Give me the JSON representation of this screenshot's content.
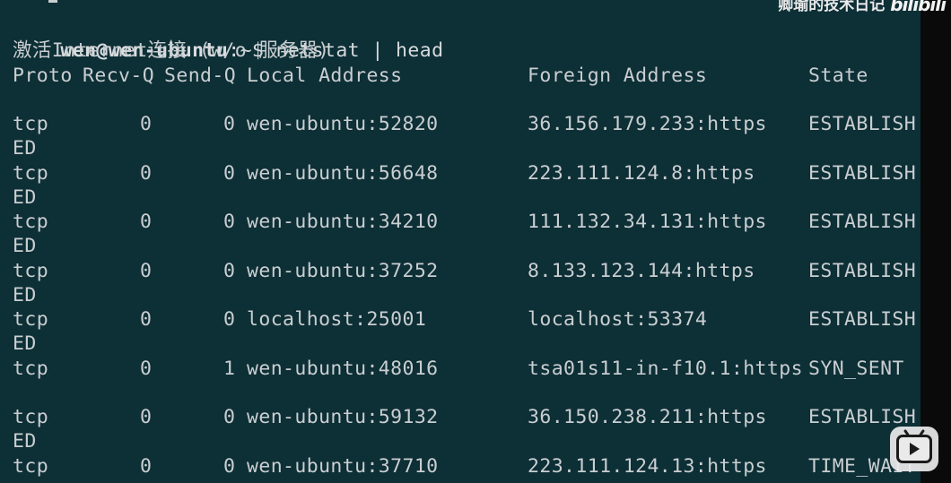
{
  "prompt": {
    "user_host": "wen@wen-ubuntu",
    "path": ":~$",
    "command": " netstat | head"
  },
  "heading": "激活Internet连接 (w/o 服务器)",
  "headers": {
    "proto": "Proto",
    "recvq": "Recv-Q",
    "sendq": "Send-Q",
    "local": "Local Address",
    "foreign": "Foreign Address",
    "state": "State"
  },
  "rows": [
    {
      "proto": "tcp",
      "recvq": "0",
      "sendq": "0",
      "local": "wen-ubuntu:52820",
      "foreign": "36.156.179.233:https",
      "state": "ESTABLISH",
      "wrap": "ED"
    },
    {
      "proto": "tcp",
      "recvq": "0",
      "sendq": "0",
      "local": "wen-ubuntu:56648",
      "foreign": "223.111.124.8:https",
      "state": "ESTABLISH",
      "wrap": "ED"
    },
    {
      "proto": "tcp",
      "recvq": "0",
      "sendq": "0",
      "local": "wen-ubuntu:34210",
      "foreign": "111.132.34.131:https",
      "state": "ESTABLISH",
      "wrap": "ED"
    },
    {
      "proto": "tcp",
      "recvq": "0",
      "sendq": "0",
      "local": "wen-ubuntu:37252",
      "foreign": "8.133.123.144:https",
      "state": "ESTABLISH",
      "wrap": "ED"
    },
    {
      "proto": "tcp",
      "recvq": "0",
      "sendq": "0",
      "local": "localhost:25001",
      "foreign": "localhost:53374",
      "state": "ESTABLISH",
      "wrap": "ED"
    },
    {
      "proto": "tcp",
      "recvq": "0",
      "sendq": "1",
      "local": "wen-ubuntu:48016",
      "foreign": "tsa01s11-in-f10.1:https",
      "state": "SYN_SENT",
      "wrap": ""
    },
    {
      "proto": "tcp",
      "recvq": "0",
      "sendq": "0",
      "local": "wen-ubuntu:59132",
      "foreign": "36.150.238.211:https",
      "state": "ESTABLISH",
      "wrap": "ED"
    },
    {
      "proto": "tcp",
      "recvq": "0",
      "sendq": "0",
      "local": "wen-ubuntu:37710",
      "foreign": "223.111.124.13:https",
      "state": "TIME_WAIT",
      "wrap": ""
    }
  ],
  "watermark": {
    "text": "卿瑜的技术日记",
    "logo": "bilibili"
  },
  "badge_icon": "bilibili-tv-icon",
  "colors": {
    "terminal_bg": "#0d2f36",
    "text": "#c9ced1"
  }
}
